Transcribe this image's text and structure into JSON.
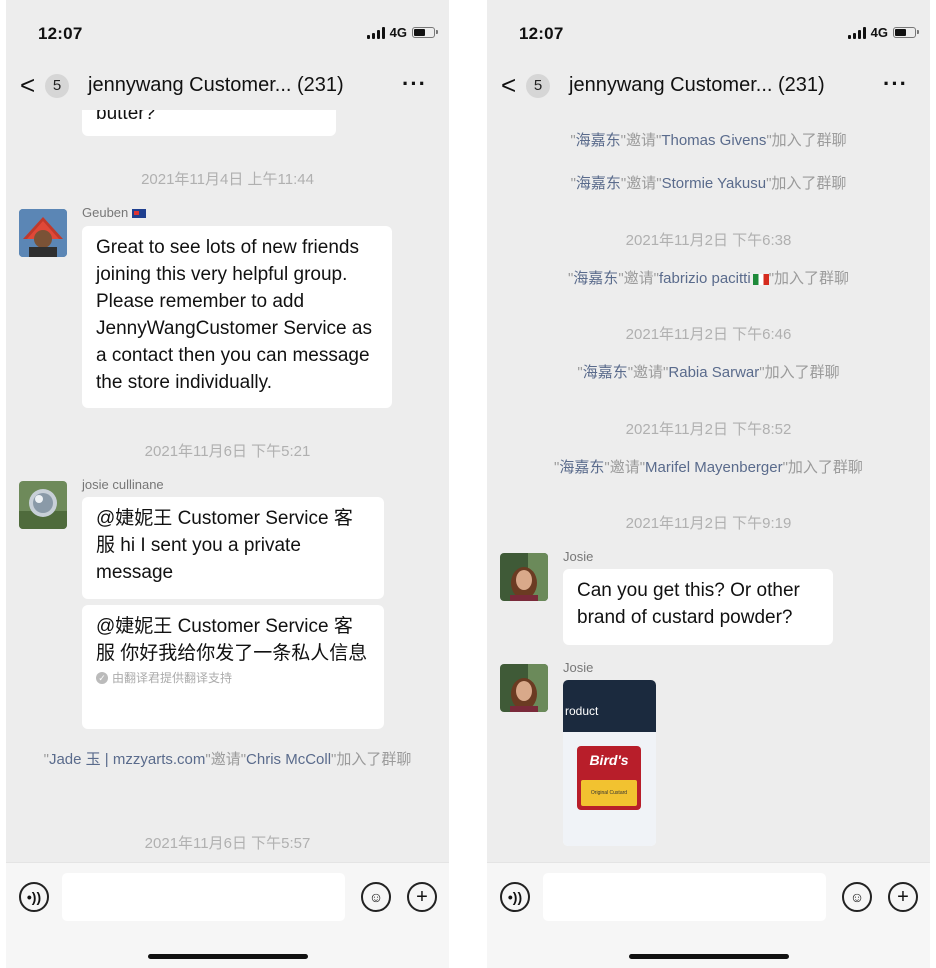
{
  "left": {
    "status": {
      "time": "12:07",
      "network": "4G"
    },
    "header": {
      "back_label": "<",
      "unread_count": "5",
      "title": "jennywang  Customer... (231)",
      "more_label": "···"
    },
    "messages": {
      "prev_bubble_tail": "butter?",
      "ts1": "2021年11月4日 上午11:44",
      "m1_sender": "Geuben",
      "m1_text": "Great to see lots of new friends joining this very helpful group. Please remember to add JennyWangCustomer Service as a contact then you can message the store individually.",
      "ts2": "2021年11月6日 下午5:21",
      "m2_sender": "josie cullinane",
      "m2_text": "@婕妮王 Customer Service 客服 hi I sent you a private message",
      "m3_text": "@婕妮王 Customer Service 客服 你好我给你发了一条私人信息",
      "translation_note": "由翻译君提供翻译支持",
      "sys1_q1": "\"",
      "sys1_inviter": "Jade 玉 | mzzyarts.com",
      "sys1_mid": "\"邀请\"",
      "sys1_invitee": "Chris McColl",
      "sys1_end": "\"加入了群聊",
      "ts3": "2021年11月6日 下午5:57"
    }
  },
  "right": {
    "status": {
      "time": "12:07",
      "network": "4G"
    },
    "header": {
      "back_label": "<",
      "unread_count": "5",
      "title": "jennywang  Customer... (231)",
      "more_label": "···"
    },
    "messages": {
      "inviter": "海嘉东",
      "q": "\"",
      "mid": "\"邀请\"",
      "end": "\"加入了群聊",
      "inv1": "Thomas Givens",
      "inv2": "Stormie Yakusu",
      "ts1": "2021年11月2日 下午6:38",
      "inv3": "fabrizio pacitti",
      "ts2": "2021年11月2日 下午6:46",
      "inv4": "Rabia Sarwar",
      "ts3": "2021年11月2日 下午8:52",
      "inv5": "Marifel Mayenberger",
      "ts4": "2021年11月2日 下午9:19",
      "m1_sender": "Josie",
      "m1_text": "Can you get this? Or other brand of custard powder?",
      "m2_sender": "Josie",
      "img_text_product": "roduct",
      "img_text_brand": "Bird's",
      "img_text_label": "Original Custard"
    }
  },
  "icons": [
    "voice-icon",
    "emoji-icon",
    "add-icon",
    "signal-icon",
    "battery-icon"
  ],
  "colors": {
    "background": "#ededed",
    "bubble": "#ffffff",
    "system_name": "#5a6b8c",
    "timestamp": "#b0b0b0"
  }
}
